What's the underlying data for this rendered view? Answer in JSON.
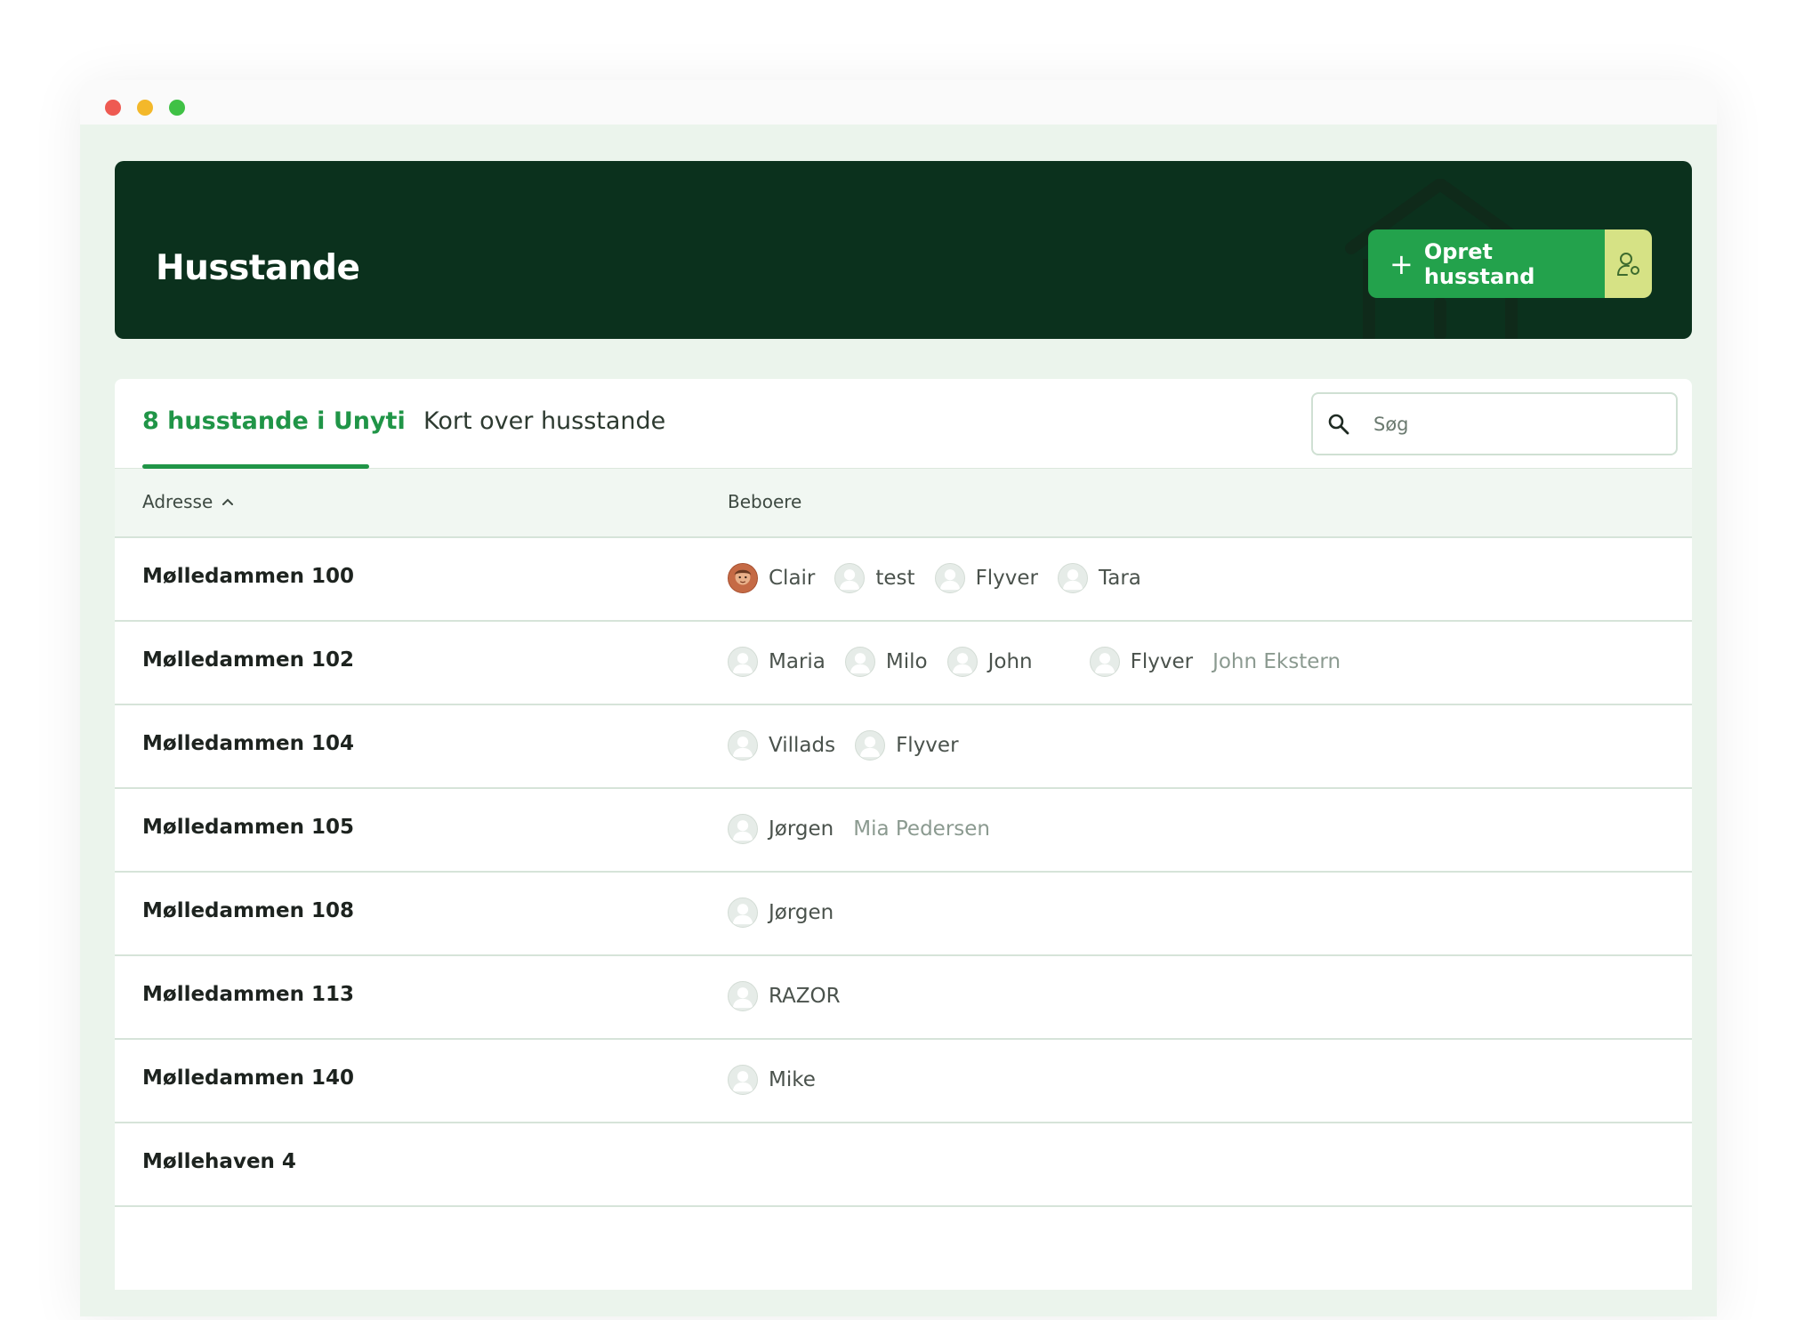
{
  "page": {
    "title": "Husstande",
    "create_button_label": "Opret husstand"
  },
  "tabs": [
    {
      "label": "8 husstande i Unyti",
      "active": true
    },
    {
      "label": "Kort over husstande",
      "active": false
    }
  ],
  "search": {
    "placeholder": "Søg"
  },
  "table": {
    "columns": {
      "address": "Adresse",
      "residents": "Beboere"
    },
    "rows": [
      {
        "address": "Mølledammen 100",
        "residents": [
          {
            "name": "Clair",
            "photo": true
          },
          {
            "name": "test"
          },
          {
            "name": "Flyver"
          },
          {
            "name": "Tara"
          }
        ],
        "external": []
      },
      {
        "address": "Mølledammen 102",
        "residents": [
          {
            "name": "Maria"
          },
          {
            "name": "Milo"
          },
          {
            "name": "John"
          },
          {
            "name": "Flyver"
          }
        ],
        "external": [
          "John Ekstern"
        ]
      },
      {
        "address": "Mølledammen 104",
        "residents": [
          {
            "name": "Villads"
          },
          {
            "name": "Flyver"
          }
        ],
        "external": []
      },
      {
        "address": "Mølledammen 105",
        "residents": [
          {
            "name": "Jørgen"
          }
        ],
        "external": [
          "Mia Pedersen"
        ]
      },
      {
        "address": "Mølledammen 108",
        "residents": [
          {
            "name": "Jørgen"
          }
        ],
        "external": []
      },
      {
        "address": "Mølledammen 113",
        "residents": [
          {
            "name": "RAZOR"
          }
        ],
        "external": []
      },
      {
        "address": "Mølledammen 140",
        "residents": [
          {
            "name": "Mike"
          }
        ],
        "external": []
      },
      {
        "address": "Møllehaven 4",
        "residents": [],
        "external": []
      }
    ]
  },
  "icons": {
    "create": "plus-icon",
    "user_settings": "user-settings-icon",
    "search": "search-icon",
    "sort": "chevron-up-icon",
    "avatar": "avatar-placeholder-icon"
  },
  "colors": {
    "banner": "#0b311d",
    "accent": "#23a24c",
    "accent_secondary": "#d6e285",
    "app_background": "#ebf4ec"
  }
}
